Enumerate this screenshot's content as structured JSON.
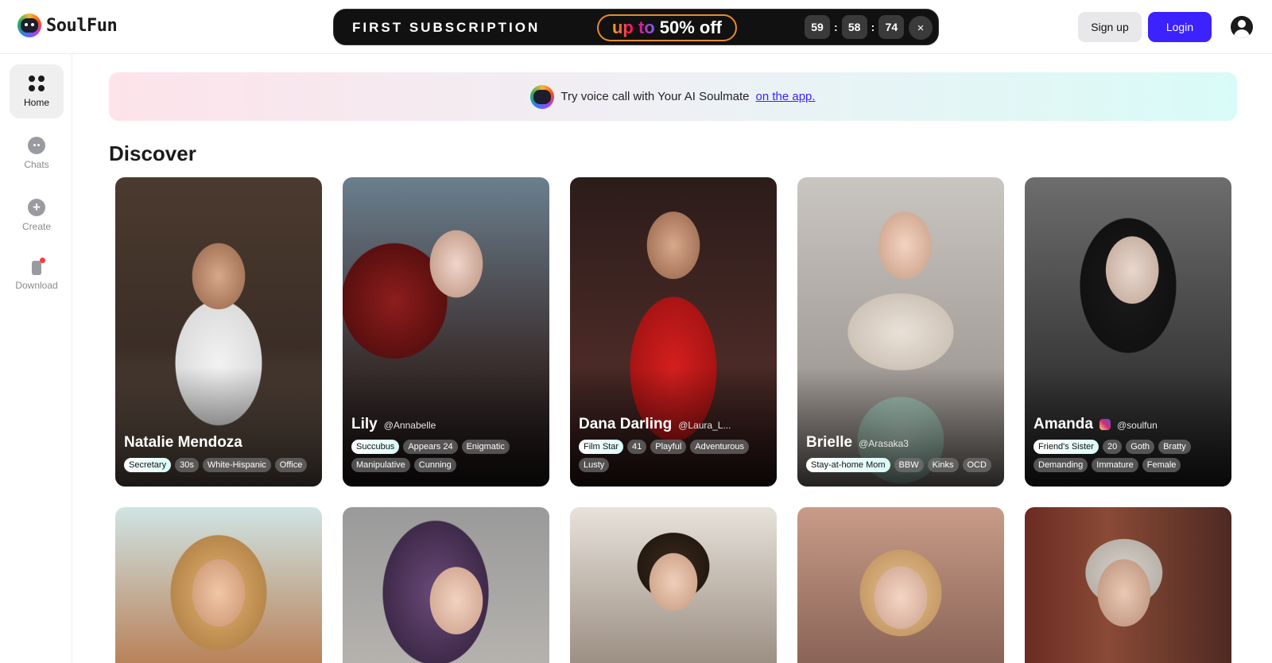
{
  "app": {
    "name": "SoulFun"
  },
  "promo": {
    "title": "FIRST SUBSCRIPTION",
    "badge_upto": "up to",
    "badge_off": "50% off",
    "timer": [
      "59",
      "58",
      "74"
    ],
    "timer_sep": ":",
    "close_glyph": "×"
  },
  "header": {
    "signup_label": "Sign up",
    "login_label": "Login"
  },
  "sidebar": {
    "items": [
      {
        "label": "Home",
        "icon": "home-grid-icon",
        "active": true
      },
      {
        "label": "Chats",
        "icon": "chat-icon"
      },
      {
        "label": "Create",
        "icon": "plus-circle-icon"
      },
      {
        "label": "Download",
        "icon": "phone-icon",
        "badge": true
      }
    ]
  },
  "banner": {
    "text": "Try voice call with Your AI Soulmate",
    "link": "on the app."
  },
  "discover": {
    "title": "Discover"
  },
  "cards": [
    {
      "name": "Natalie Mendoza",
      "handle": "",
      "tags": [
        "Secretary",
        "30s",
        "White-Hispanic",
        "Office"
      ]
    },
    {
      "name": "Lily",
      "handle": "@Annabelle",
      "tags": [
        "Succubus",
        "Appears 24",
        "Enigmatic",
        "Manipulative",
        "Cunning"
      ]
    },
    {
      "name": "Dana Darling",
      "handle": "@Laura_L...",
      "tags": [
        "Film Star",
        "41",
        "Playful",
        "Adventurous",
        "Lusty"
      ]
    },
    {
      "name": "Brielle",
      "handle": "@Arasaka3",
      "tags": [
        "Stay-at-home Mom",
        "BBW",
        "Kinks",
        "OCD"
      ]
    },
    {
      "name": "Amanda",
      "handle": "@soulfun",
      "instagram": true,
      "tags": [
        "Friend's Sister",
        "20",
        "Goth",
        "Bratty",
        "Demanding",
        "Immature",
        "Female"
      ]
    }
  ],
  "colors": {
    "accent": "#3b22ff",
    "promo_bg": "#111111",
    "link": "#3b22ff"
  }
}
